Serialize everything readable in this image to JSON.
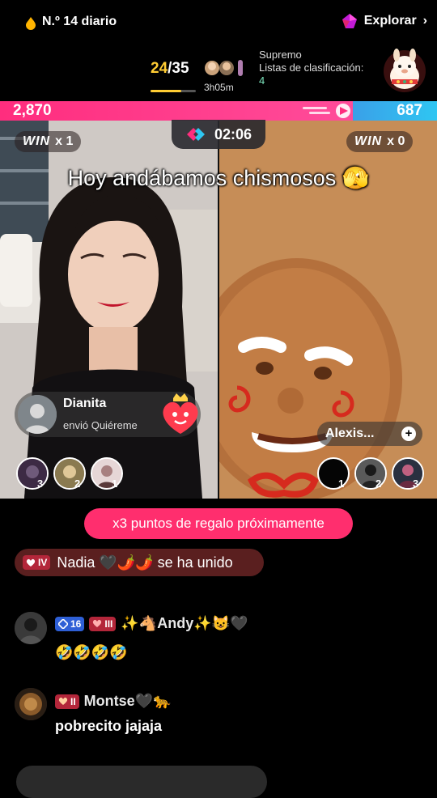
{
  "top": {
    "daily_rank": "N.º 14 diario",
    "explore_label": "Explorar",
    "explore_chevron": "›",
    "score_current": "24",
    "score_total": "/35",
    "score_progress": 0.686,
    "timer_small": "3h05m",
    "rank_title": "Supremo",
    "rank_list": "Listas de clasificación:",
    "rank_level": "4"
  },
  "battle": {
    "left_points": "2,870",
    "right_points": "687",
    "win_left_word": "WIN",
    "win_left_count": "x 1",
    "win_right_word": "WIN",
    "win_right_count": "x 0",
    "timer": "02:06",
    "caption": "Hoy andábamos chismosos 🫣"
  },
  "gift": {
    "sender": "Dianita",
    "sent_prefix": "envió",
    "gift_name": "Quiéreme"
  },
  "right_host": {
    "name": "Alexis...",
    "plus": "+"
  },
  "left_fans": [
    {
      "rank": "3"
    },
    {
      "rank": "2"
    },
    {
      "rank": "1"
    }
  ],
  "right_fans": [
    {
      "rank": "1"
    },
    {
      "rank": "2"
    },
    {
      "rank": "3"
    }
  ],
  "promo": "x3 puntos de regalo próximamente",
  "joined": {
    "badge": "IV",
    "text": "Nadia 🖤🌶️🌶️ se ha unido"
  },
  "comments": [
    {
      "badge_blue": "16",
      "badge_red": "III",
      "name": "✨🐴Andy✨😺🖤",
      "text": "🤣🤣🤣🤣"
    },
    {
      "badge_red": "II",
      "name": "Montse🖤🐆",
      "text": "pobrecito jajaja"
    }
  ],
  "colors": {
    "pink": "#ff2e6e",
    "blue": "#2fc6f2",
    "gold": "#ffcc33"
  }
}
